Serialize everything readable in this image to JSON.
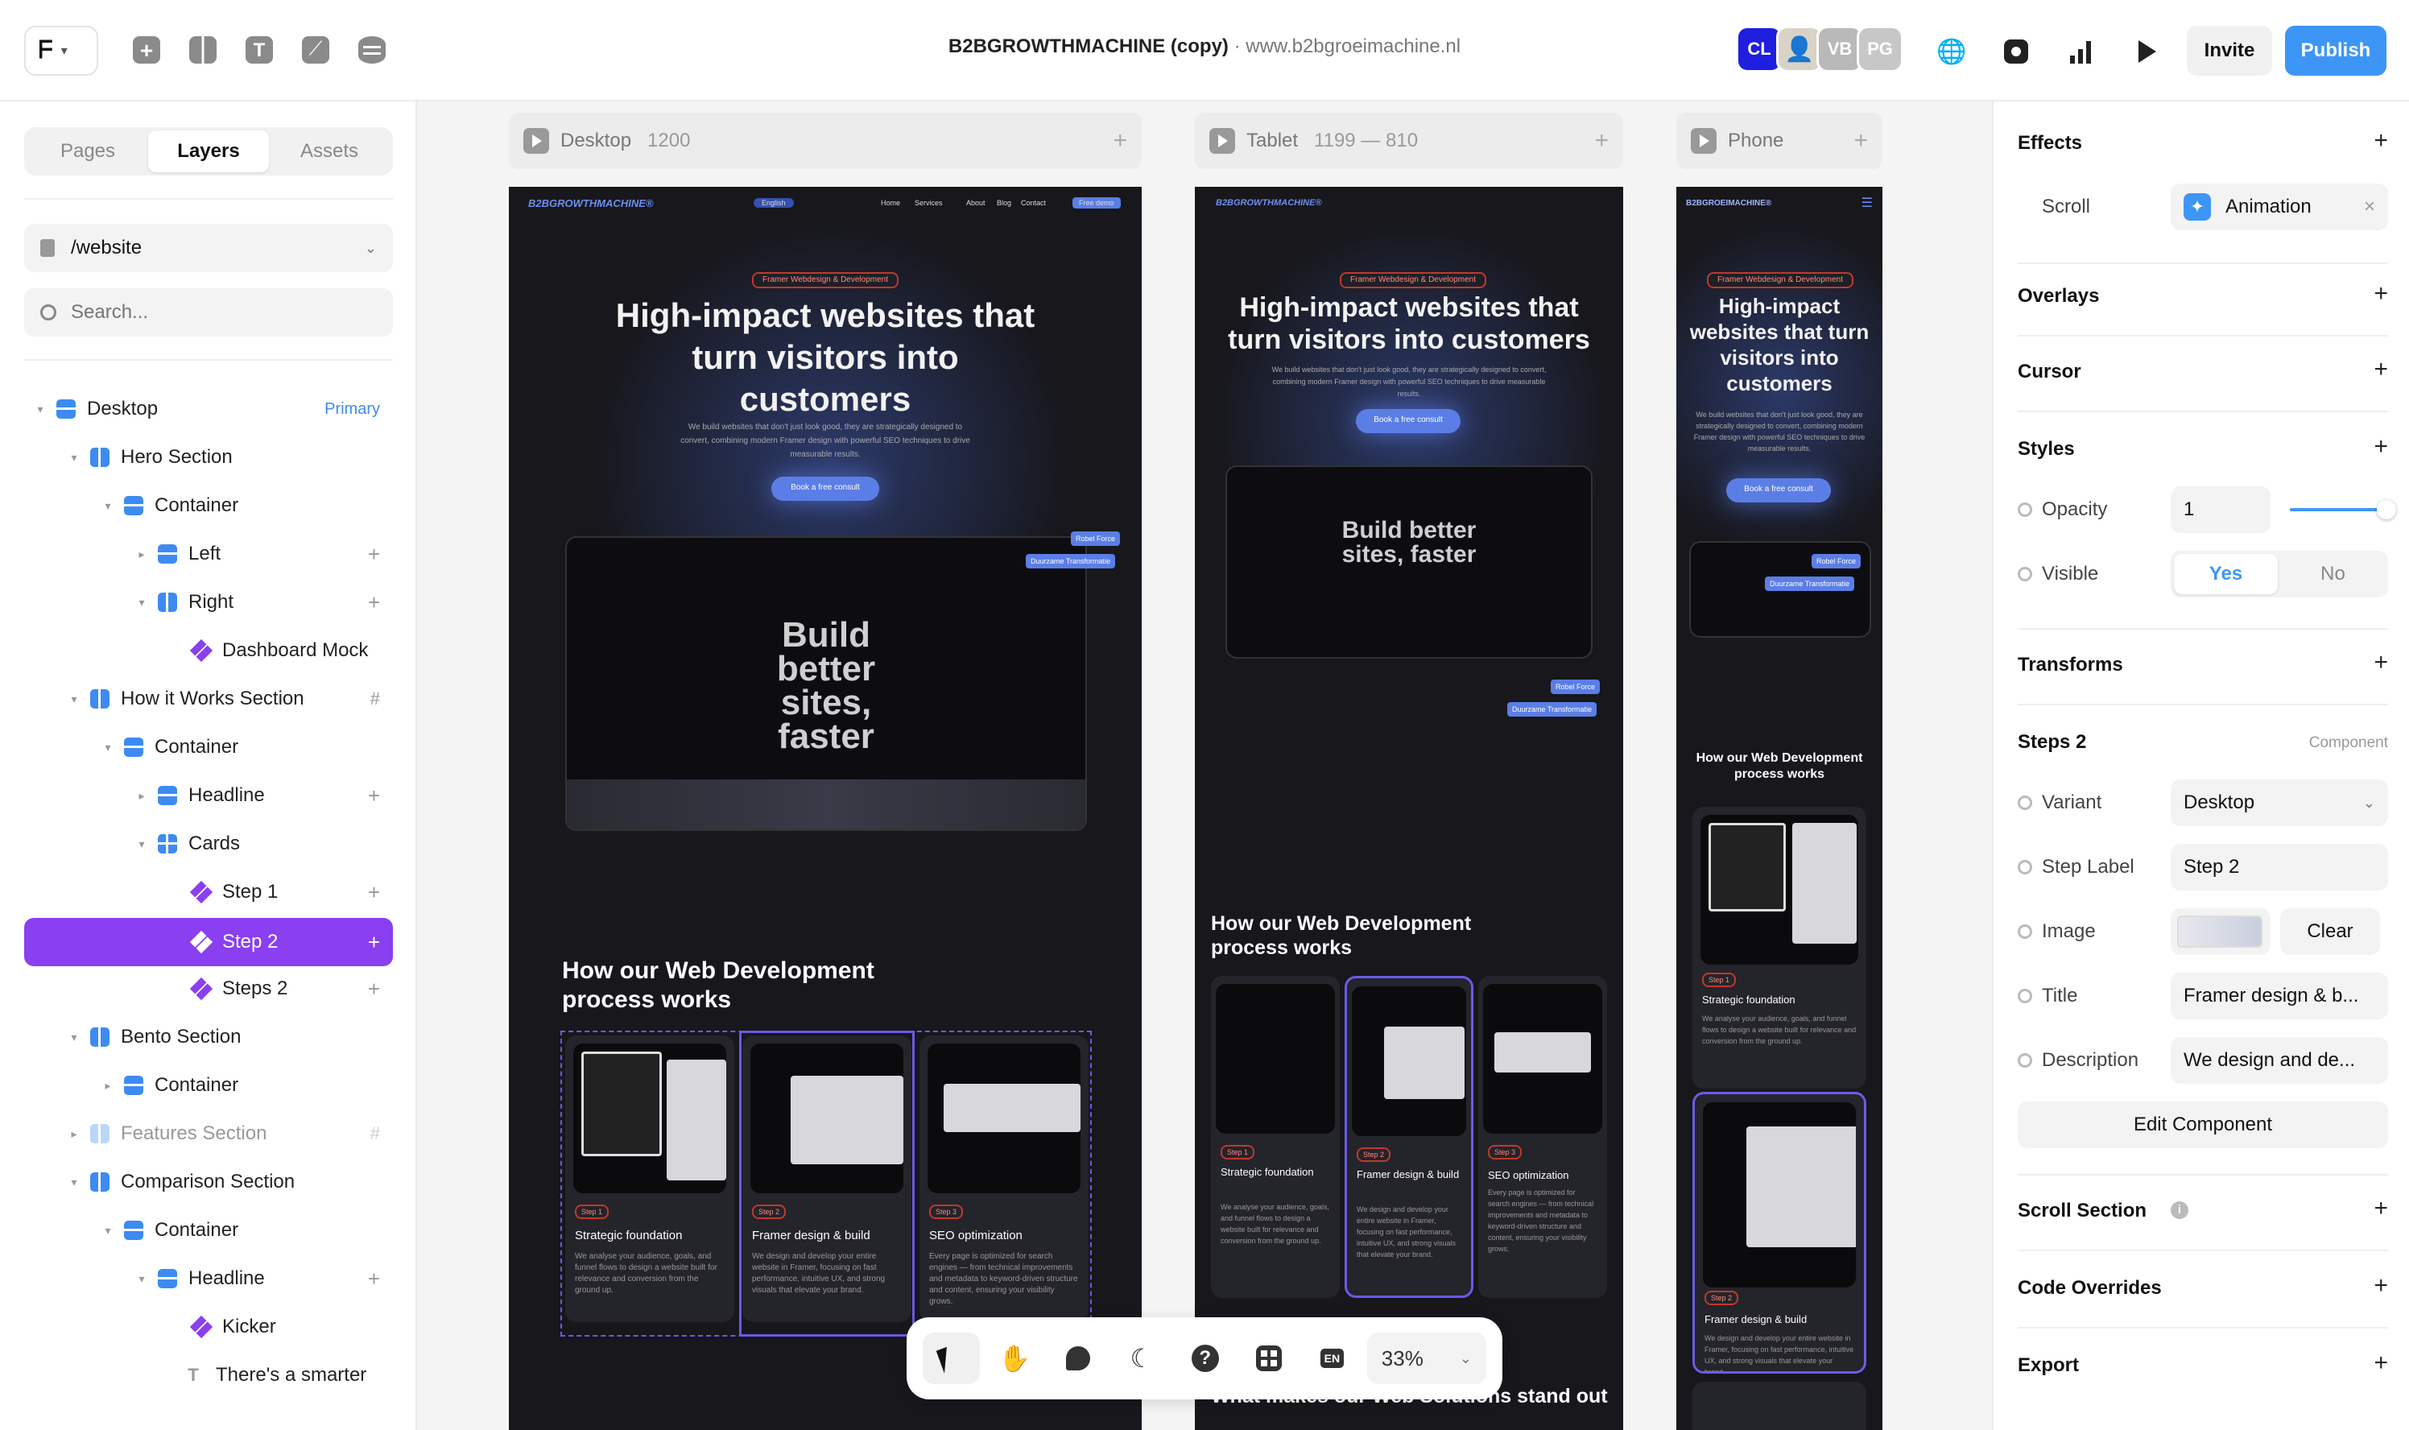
{
  "topbar": {
    "project": "B2BGROWTHMACHINE (copy)",
    "separator": "·",
    "domain": "www.b2bgroeimachine.nl",
    "avatars": [
      "CL",
      "VB",
      "PG"
    ],
    "invite": "Invite",
    "publish": "Publish"
  },
  "left": {
    "tabs": [
      "Pages",
      "Layers",
      "Assets"
    ],
    "page": "/website",
    "search_placeholder": "Search...",
    "layers": [
      {
        "label": "Desktop",
        "badge": "Primary"
      },
      {
        "label": "Hero Section"
      },
      {
        "label": "Container"
      },
      {
        "label": "Left"
      },
      {
        "label": "Right"
      },
      {
        "label": "Dashboard Mock"
      },
      {
        "label": "How it Works Section"
      },
      {
        "label": "Container"
      },
      {
        "label": "Headline"
      },
      {
        "label": "Cards"
      },
      {
        "label": "Step 1"
      },
      {
        "label": "Step 2"
      },
      {
        "label": "Steps 2"
      },
      {
        "label": "Bento Section"
      },
      {
        "label": "Container"
      },
      {
        "label": "Features Section"
      },
      {
        "label": "Comparison Section"
      },
      {
        "label": "Container"
      },
      {
        "label": "Headline"
      },
      {
        "label": "Kicker"
      },
      {
        "label": "There's a smarter"
      }
    ]
  },
  "canvas": {
    "desktop": {
      "label": "Desktop",
      "size": "1200",
      "brand": "B2BGROWTHMACHINE®",
      "lang": "English",
      "nav": [
        "Home",
        "Services",
        "About",
        "Blog",
        "Contact"
      ],
      "nav_cta": "Free demo",
      "pill": "Framer Webdesign & Development",
      "headline": "High-impact websites that turn visitors into customers",
      "para": "We build websites that don't just look good, they are strategically designed to convert, combining modern Framer design with powerful SEO techniques to drive measurable results.",
      "cta": "Book a free consult",
      "dash_title": "Build better sites, faster",
      "tag1": "Robel Force",
      "tag2": "Duurzame Transformatie",
      "section": "How our Web Development process works",
      "cards": [
        {
          "step": "Step 1",
          "title": "Strategic foundation",
          "desc": "We analyse your audience, goals, and funnel flows to design a website built for relevance and conversion from the ground up."
        },
        {
          "step": "Step 2",
          "title": "Framer design & build",
          "desc": "We design and develop your entire website in Framer, focusing on fast performance, intuitive UX, and strong visuals that elevate your brand."
        },
        {
          "step": "Step 3",
          "title": "SEO optimization",
          "desc": "Every page is optimized for search engines — from technical improvements and metadata to keyword-driven structure and content, ensuring your visibility grows."
        }
      ]
    },
    "tablet": {
      "label": "Tablet",
      "size": "1199 — 810",
      "headline": "High-impact websites that turn visitors into customers",
      "section": "How our Web Development process works",
      "next": "What makes our Web Solutions stand out"
    },
    "phone": {
      "label": "Phone",
      "brand": "B2BGROEIMACHINE®",
      "headline": "High-impact websites that turn visitors into customers",
      "section": "How our Web Development process works"
    },
    "zoom": "33%"
  },
  "right": {
    "effects": "Effects",
    "scroll_label": "Scroll",
    "animation": "Animation",
    "overlays": "Overlays",
    "cursor": "Cursor",
    "styles": "Styles",
    "opacity_label": "Opacity",
    "opacity_value": "1",
    "visible_label": "Visible",
    "yes": "Yes",
    "no": "No",
    "transforms": "Transforms",
    "component_name": "Steps 2",
    "component_tag": "Component",
    "variant_label": "Variant",
    "variant_value": "Desktop",
    "step_label": "Step Label",
    "step_value": "Step 2",
    "image_label": "Image",
    "clear": "Clear",
    "title_label": "Title",
    "title_value": "Framer design & b...",
    "desc_label": "Description",
    "desc_value": "We design and de...",
    "edit": "Edit Component",
    "scroll_section": "Scroll Section",
    "code_overrides": "Code Overrides",
    "export": "Export"
  }
}
